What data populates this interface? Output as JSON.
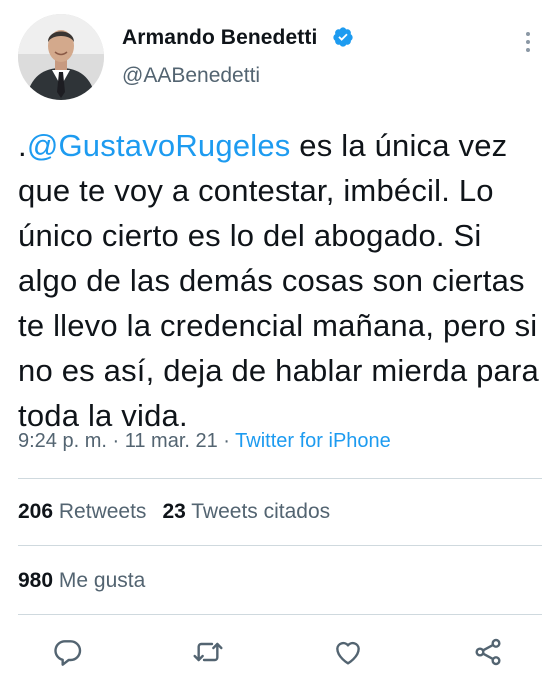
{
  "author": {
    "display_name": "Armando Benedetti",
    "handle": "@AABenedetti",
    "verified": true,
    "avatar_icon": "profile-photo"
  },
  "tweet": {
    "prefix": ".",
    "mention": "@GustavoRugeles",
    "body": " es la única vez que te voy a contestar, imbécil. Lo único cierto es lo del abogado. Si algo de las demás cosas son ciertas te llevo la credencial mañana, pero si no es así, deja de hablar mierda para toda la vida."
  },
  "meta": {
    "time": "9:24 p. m.",
    "sep1": " · ",
    "date": "11 mar. 21",
    "sep2": " · ",
    "source": "Twitter for iPhone"
  },
  "stats": {
    "retweets_count": "206",
    "retweets_label": "Retweets",
    "quotes_count": "23",
    "quotes_label": "Tweets citados",
    "likes_count": "980",
    "likes_label": "Me gusta"
  },
  "actions": {
    "reply_icon": "reply-icon",
    "retweet_icon": "retweet-icon",
    "like_icon": "heart-icon",
    "share_icon": "share-icon"
  },
  "colors": {
    "accent": "#1d9bf0",
    "text": "#0f1419",
    "secondary": "#536471",
    "divider": "#cfd9de"
  }
}
